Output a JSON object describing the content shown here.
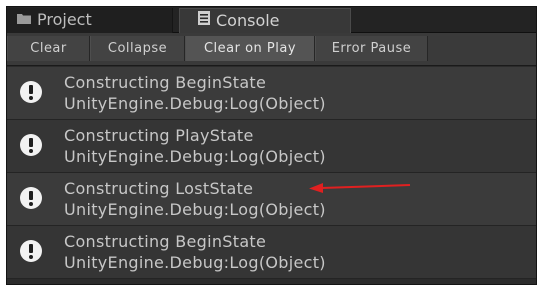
{
  "tabs": [
    {
      "label": "Project",
      "icon": "folder-icon",
      "active": false
    },
    {
      "label": "Console",
      "icon": "console-icon",
      "active": true
    }
  ],
  "toolbar": {
    "buttons": [
      {
        "label": "Clear",
        "active": false
      },
      {
        "label": "Collapse",
        "active": false
      },
      {
        "label": "Clear on Play",
        "active": true
      },
      {
        "label": "Error Pause",
        "active": false
      }
    ]
  },
  "log_entries": [
    {
      "message": "Constructing BeginState",
      "source": "UnityEngine.Debug:Log(Object)",
      "icon": "info-icon"
    },
    {
      "message": "Constructing PlayState",
      "source": "UnityEngine.Debug:Log(Object)",
      "icon": "info-icon"
    },
    {
      "message": "Constructing LostState",
      "source": "UnityEngine.Debug:Log(Object)",
      "icon": "info-icon"
    },
    {
      "message": "Constructing BeginState",
      "source": "UnityEngine.Debug:Log(Object)",
      "icon": "info-icon"
    }
  ],
  "annotation": {
    "type": "red-arrow",
    "color": "#e02020",
    "points_to": "Constructing LostState"
  },
  "colors": {
    "panel": "#2b2b2b",
    "toolbar": "#3a3a3a",
    "text": "#c7c7c7",
    "arrow": "#e02020"
  }
}
